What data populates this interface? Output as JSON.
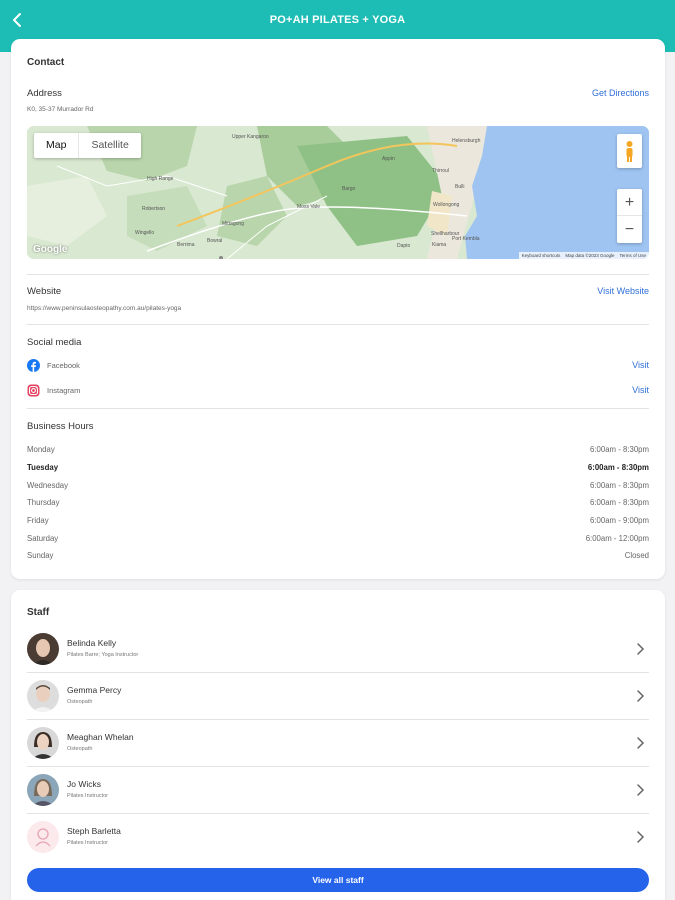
{
  "header": {
    "title": "PO+AH PILATES + YOGA",
    "back_icon": "back-arrow-icon"
  },
  "contact": {
    "title": "Contact",
    "address_label": "Address",
    "address_value": "K0, 35-37 Murrador Rd",
    "get_directions": "Get Directions",
    "map": {
      "map_button": "Map",
      "satellite_button": "Satellite",
      "zoom_in": "+",
      "zoom_out": "−",
      "google_logo": "Google",
      "attrib_shortcuts": "Keyboard shortcuts",
      "attrib_data": "Map data ©2023 Google",
      "attrib_terms": "Terms of Use",
      "places": [
        "High Range",
        "Mittagong",
        "Bowral",
        "Upper Kangaroo",
        "Moss Vale",
        "Kiama",
        "Shellharbour",
        "Wollongong",
        "Dapto",
        "Port Kembla",
        "Helensburgh",
        "Bulli",
        "Thirroul",
        "Robertson",
        "Berrima",
        "Wingello",
        "Bargo",
        "Appin"
      ],
      "water_color": "#9fc4f2",
      "land_color": "#d6e6d0"
    },
    "website_label": "Website",
    "website_value": "https://www.peninsulaosteopathy.com.au/pilates-yoga",
    "visit_website": "Visit Website",
    "social_label": "Social media",
    "social": [
      {
        "name": "Facebook",
        "icon": "facebook-icon",
        "action": "Visit"
      },
      {
        "name": "Instagram",
        "icon": "instagram-icon",
        "action": "Visit"
      }
    ],
    "hours_label": "Business Hours",
    "hours": [
      {
        "day": "Monday",
        "time": "6:00am - 8:30pm"
      },
      {
        "day": "Tuesday",
        "time": "6:00am - 8:30pm"
      },
      {
        "day": "Wednesday",
        "time": "6:00am - 8:30pm"
      },
      {
        "day": "Thursday",
        "time": "6:00am - 8:30pm"
      },
      {
        "day": "Friday",
        "time": "6:00am - 9:00pm"
      },
      {
        "day": "Saturday",
        "time": "6:00am - 12:00pm"
      },
      {
        "day": "Sunday",
        "time": "Closed"
      }
    ]
  },
  "staff": {
    "title": "Staff",
    "members": [
      {
        "name": "Belinda Kelly",
        "role": "Pilates Barre; Yoga Instructor"
      },
      {
        "name": "Gemma Percy",
        "role": "Osteopath"
      },
      {
        "name": "Meaghan Whelan",
        "role": "Osteopath"
      },
      {
        "name": "Jo Wicks",
        "role": "Pilates Instructor"
      },
      {
        "name": "Steph Barletta",
        "role": "Pilates Instructor"
      }
    ],
    "view_all": "View all staff"
  },
  "colors": {
    "header": "#1dbdb5",
    "link": "#2f6fd8",
    "button": "#2563eb"
  }
}
